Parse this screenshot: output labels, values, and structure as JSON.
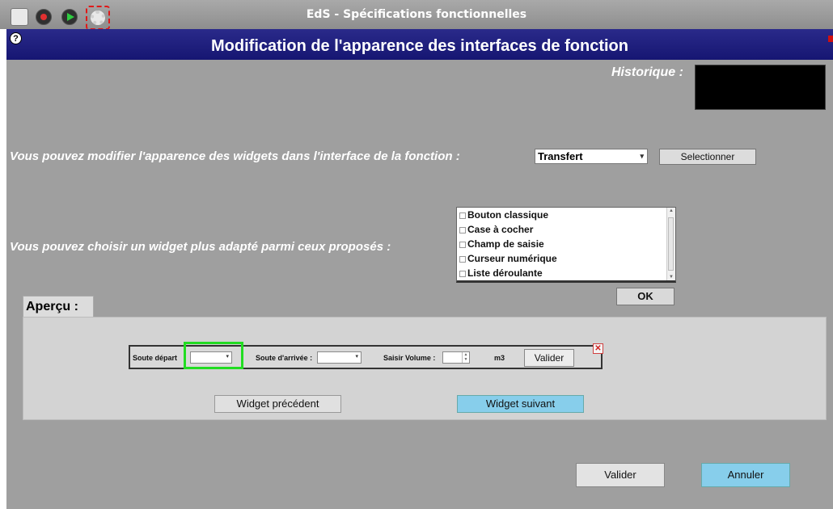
{
  "window": {
    "title": "EdS - Spécifications fonctionnelles"
  },
  "toolbar": {
    "icons": [
      "refresh-icon",
      "record-icon",
      "play-icon",
      "gear-icon"
    ]
  },
  "header": {
    "help_glyph": "?",
    "title": "Modification de l'apparence des interfaces de fonction"
  },
  "historique": {
    "label": "Historique :"
  },
  "function_row": {
    "prompt": "Vous pouvez modifier l'apparence des widgets dans l'interface de la fonction :",
    "selected_function": "Transfert",
    "select_button": "Selectionner"
  },
  "widget_row": {
    "prompt": "Vous pouvez choisir un widget plus adapté parmi ceux proposés :",
    "options": [
      "Bouton classique",
      "Case à cocher",
      "Champ de saisie",
      "Curseur numérique",
      "Liste déroulante"
    ],
    "ok_button": "OK"
  },
  "apercu": {
    "label": "Aperçu :",
    "preview": {
      "soute_depart_label": "Soute départ",
      "soute_arrivee_label": "Soute d'arrivée :",
      "volume_label": "Saisir Volume :",
      "unit": "m3",
      "valider_button": "Valider",
      "close_glyph": "✕"
    },
    "prev_button": "Widget précédent",
    "next_button": "Widget suivant"
  },
  "footer": {
    "valider_button": "Valider",
    "annuler_button": "Annuler"
  },
  "colors": {
    "header_blue": "#1a1a7a",
    "panel_grey": "#9f9f9f",
    "accent_blue": "#87ceeb",
    "highlight_green": "#22dd22",
    "highlight_red": "#e01818"
  }
}
